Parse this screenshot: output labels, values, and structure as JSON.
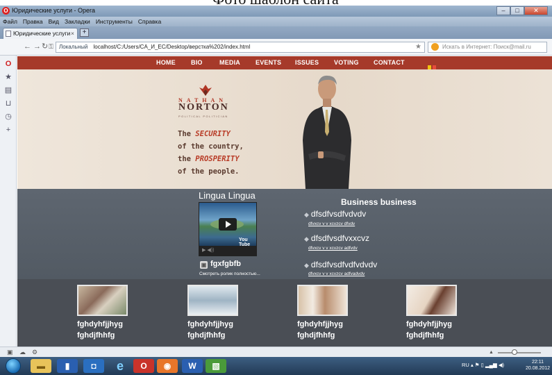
{
  "caption_top": "Фото шаблон сайта",
  "window": {
    "title": "Юридические услуги - Opera",
    "controls": [
      "–",
      "□",
      "✕"
    ]
  },
  "menu": [
    "Файл",
    "Правка",
    "Вид",
    "Закладки",
    "Инструменты",
    "Справка"
  ],
  "tabs": [
    {
      "label": "Юридические услуги",
      "close": "×"
    }
  ],
  "new_tab_label": "+",
  "address": {
    "security_label": "Локальный",
    "url": "localhost/C:/Users/CA_И_EC/Desktop/верстка%202/index.html",
    "search_placeholder": "Искать в Интернет: Поиск@mail.ru"
  },
  "nav_icons": [
    "back-icon",
    "forward-icon",
    "reload-icon",
    "key-icon"
  ],
  "sidebar_icons": [
    "opera-icon",
    "bookmarks-star-icon",
    "notes-icon",
    "unite-icon",
    "history-icon",
    "add-panel-icon"
  ],
  "site": {
    "nav": [
      "HOME",
      "BIO",
      "MEDIA",
      "EVENTS",
      "ISSUES",
      "VOTING",
      "CONTACT"
    ],
    "logo": {
      "first": "NATHAN",
      "last": "NORTON",
      "tagline": "POLITICAL POLITICIAN"
    },
    "slogan": {
      "line1_pre": "The ",
      "line1_em": "SECURITY",
      "line2": "of the country,",
      "line3_pre": "the ",
      "line3_em": "PROSPERITY",
      "line4": "of the people."
    },
    "video": {
      "title": "Lingua Lingua",
      "caption": "fgxfgbfb",
      "link": "Смотреть ролик полностью...",
      "brand": "You Tube"
    },
    "business": {
      "heading": "Business business",
      "items": [
        {
          "title": "dfsdfvsdfvdvdv",
          "sub": "dfvxcv v v xcvzcv dfvdv"
        },
        {
          "title": "dfsdfvsdfvxxcvz",
          "sub": "dfvxcv v v xcvzcv adfvdv"
        },
        {
          "title": "dfsdfvsdfvdfvdvdv",
          "sub": "dfvxcv v v xcvzcv adfvadvdv"
        }
      ]
    },
    "gallery": [
      {
        "line1": "fghdyhfjjhyg",
        "line2": "fghdjfhhfg"
      },
      {
        "line1": "fghdyhfjjhyg",
        "line2": "fghdjfhhfg"
      },
      {
        "line1": "fghdyhfjjhyg",
        "line2": "fghdjfhhfg"
      },
      {
        "line1": "fghdyhfjjhyg",
        "line2": "fghdjfhhfg"
      }
    ]
  },
  "taskbar": {
    "language": "RU",
    "time": "22:11",
    "date": "20.08.2012"
  },
  "colors": {
    "site_nav": "#a63a2a",
    "accent_red": "#b83b26",
    "mid_band": "#5a626b",
    "bottom_band": "#4a4e55"
  }
}
